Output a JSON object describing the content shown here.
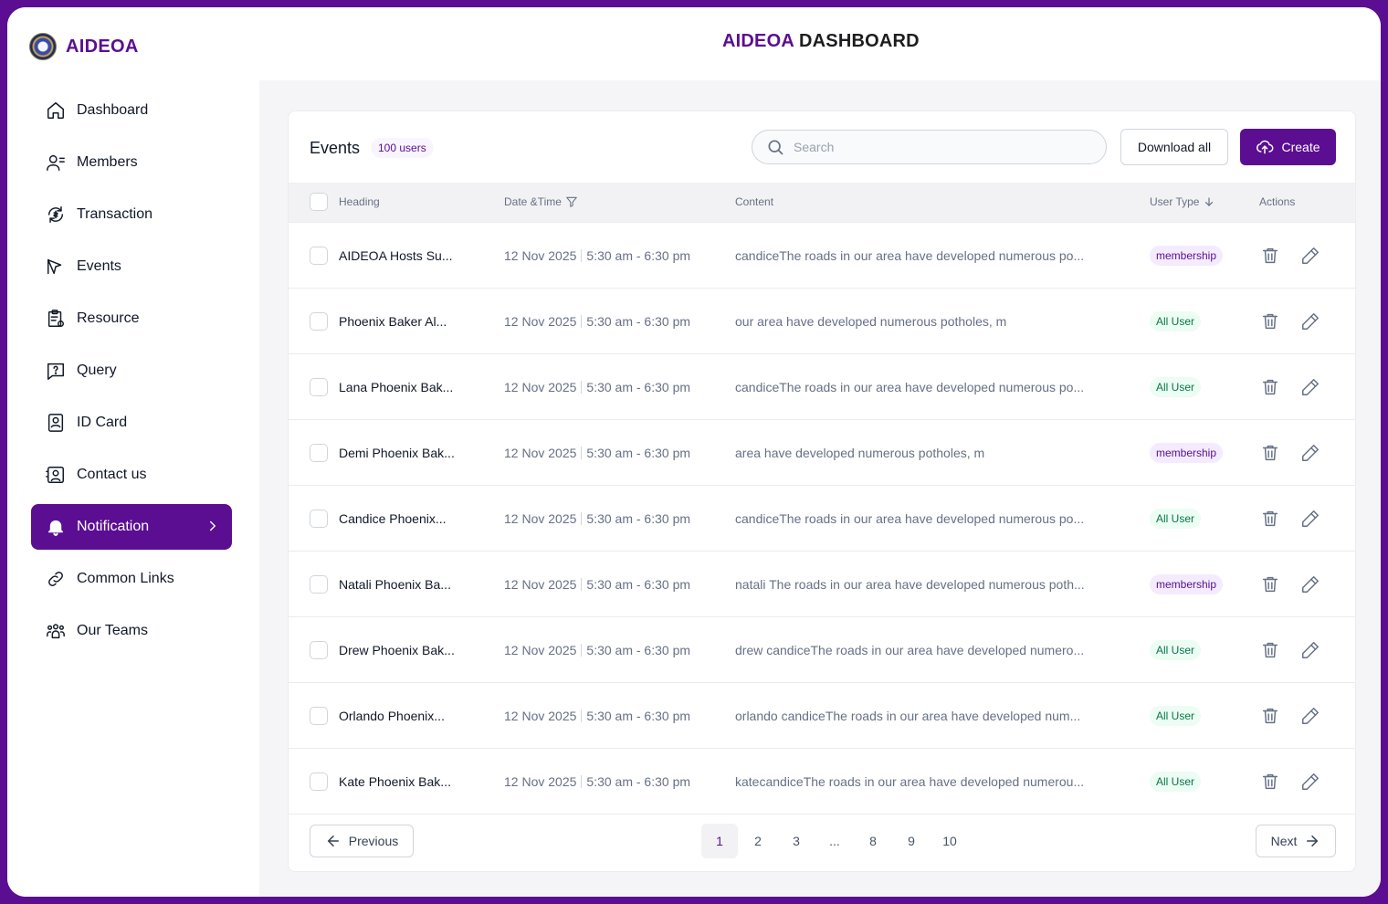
{
  "brand": {
    "name": "AIDEOA"
  },
  "header": {
    "title_accent": "AIDEOA",
    "title_rest": "DASHBOARD"
  },
  "sidebar": {
    "items": [
      {
        "label": "Dashboard",
        "icon": "home-icon"
      },
      {
        "label": "Members",
        "icon": "users-icon"
      },
      {
        "label": "Transaction",
        "icon": "transaction-icon"
      },
      {
        "label": "Events",
        "icon": "megaphone-icon"
      },
      {
        "label": "Resource",
        "icon": "clipboard-icon"
      },
      {
        "label": "Query",
        "icon": "question-icon"
      },
      {
        "label": "ID Card",
        "icon": "id-card-icon"
      },
      {
        "label": "Contact us",
        "icon": "contact-icon"
      },
      {
        "label": "Notification",
        "icon": "bell-icon",
        "active": true
      },
      {
        "label": "Common Links",
        "icon": "link-icon"
      },
      {
        "label": "Our Teams",
        "icon": "team-icon"
      }
    ]
  },
  "card": {
    "title": "Events",
    "count": "100 users",
    "search_placeholder": "Search",
    "download_label": "Download all",
    "create_label": "Create"
  },
  "table": {
    "columns": {
      "heading": "Heading",
      "datetime": "Date &Time",
      "content": "Content",
      "user_type": "User Type",
      "actions": "Actions"
    },
    "rows": [
      {
        "heading": "AIDEOA Hosts Su...",
        "date": "12 Nov 2025",
        "time": "5:30 am - 6:30 pm",
        "content": "candiceThe roads in our area have developed numerous po...",
        "user_type": "membership"
      },
      {
        "heading": "Phoenix Baker Al...",
        "date": "12 Nov 2025",
        "time": "5:30 am - 6:30 pm",
        "content": "our area have developed numerous potholes, m",
        "user_type": "All User"
      },
      {
        "heading": "Lana Phoenix Bak...",
        "date": "12 Nov 2025",
        "time": "5:30 am - 6:30 pm",
        "content": "candiceThe roads in our area have developed numerous po...",
        "user_type": "All User"
      },
      {
        "heading": "Demi Phoenix Bak...",
        "date": "12 Nov 2025",
        "time": "5:30 am - 6:30 pm",
        "content": "area have developed numerous potholes, m",
        "user_type": "membership"
      },
      {
        "heading": "Candice Phoenix...",
        "date": "12 Nov 2025",
        "time": "5:30 am - 6:30 pm",
        "content": "candiceThe roads in our area have developed numerous po...",
        "user_type": "All User"
      },
      {
        "heading": "Natali Phoenix Ba...",
        "date": "12 Nov 2025",
        "time": "5:30 am - 6:30 pm",
        "content": "natali The roads in our area have developed numerous poth...",
        "user_type": "membership"
      },
      {
        "heading": "Drew Phoenix Bak...",
        "date": "12 Nov 2025",
        "time": "5:30 am - 6:30 pm",
        "content": "drew candiceThe roads in our area have developed numero...",
        "user_type": "All User"
      },
      {
        "heading": "Orlando Phoenix...",
        "date": "12 Nov 2025",
        "time": "5:30 am - 6:30 pm",
        "content": "orlando candiceThe roads in our area have developed num...",
        "user_type": "All User"
      },
      {
        "heading": "Kate Phoenix Bak...",
        "date": "12 Nov 2025",
        "time": "5:30 am - 6:30 pm",
        "content": "katecandiceThe roads in our area have developed numerou...",
        "user_type": "All User"
      }
    ]
  },
  "pagination": {
    "prev_label": "Previous",
    "next_label": "Next",
    "pages": [
      "1",
      "2",
      "3",
      "...",
      "8",
      "9",
      "10"
    ],
    "current": "1"
  },
  "colors": {
    "brand": "#5b0e91",
    "membership_bg": "#f4ebff",
    "all_user_bg": "#ecfdf3",
    "all_user_text": "#067647"
  }
}
